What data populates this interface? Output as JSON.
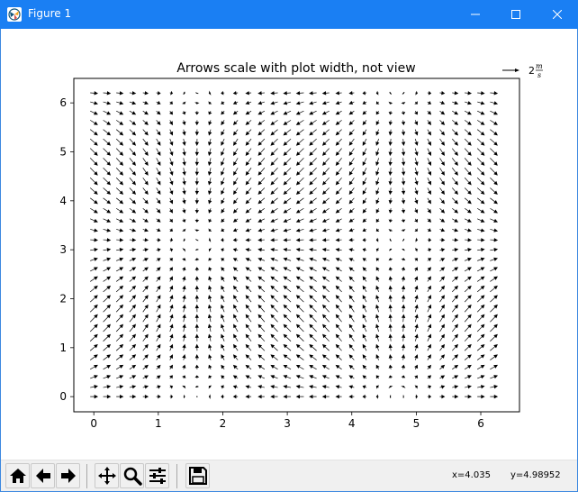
{
  "window": {
    "title": "Figure 1",
    "titlebar_color": "#1a7ff3"
  },
  "plot": {
    "title": "Arrows scale with plot width, not view",
    "quiverkey_label": "2",
    "quiverkey_unit_num": "m",
    "quiverkey_unit_den": "s"
  },
  "chart_data": {
    "type": "quiver",
    "title": "Arrows scale with plot width, not view",
    "xlabel": "",
    "ylabel": "",
    "x_ticks": [
      "0",
      "1",
      "2",
      "3",
      "4",
      "5",
      "6"
    ],
    "y_ticks": [
      "0",
      "1",
      "2",
      "3",
      "4",
      "5",
      "6"
    ],
    "xlim": [
      -0.31,
      6.6
    ],
    "ylim": [
      -0.31,
      6.5
    ],
    "grid": false,
    "field": {
      "x_range": [
        0,
        6.2
      ],
      "y_range": [
        0,
        6.2
      ],
      "step": 0.2,
      "U": "cos(X)",
      "V": "sin(Y)"
    },
    "quiverkey": {
      "value": 2,
      "label": "2 m/s",
      "position": "top-right"
    }
  },
  "toolbar": {
    "buttons": [
      {
        "name": "home-button",
        "icon": "home-icon"
      },
      {
        "name": "back-button",
        "icon": "back-arrow-icon"
      },
      {
        "name": "forward-button",
        "icon": "forward-arrow-icon"
      },
      {
        "name": "pan-button",
        "icon": "move-icon"
      },
      {
        "name": "zoom-button",
        "icon": "magnifier-icon"
      },
      {
        "name": "configure-subplots-button",
        "icon": "sliders-icon"
      },
      {
        "name": "save-button",
        "icon": "floppy-disk-icon"
      }
    ],
    "coord_x": "x=4.035",
    "coord_y": "y=4.98952"
  }
}
